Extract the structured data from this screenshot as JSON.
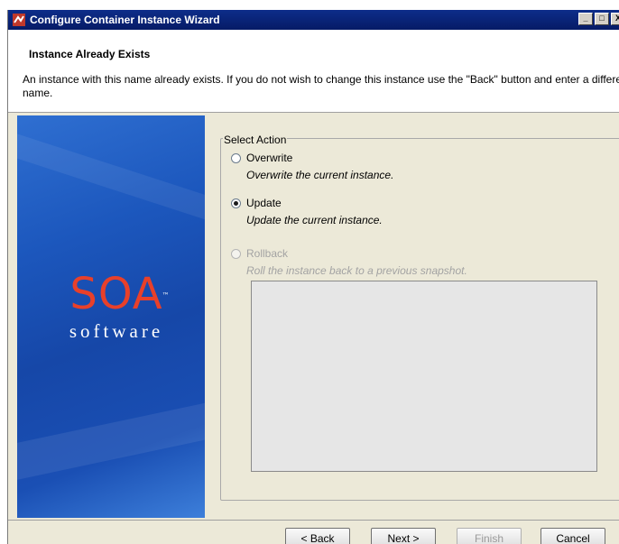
{
  "window": {
    "title": "Configure Container Instance Wizard",
    "controls": [
      "_",
      "□",
      "X"
    ]
  },
  "header": {
    "title": "Instance Already Exists",
    "description": "An instance with this name already exists.  If you do not wish to change this instance use the \"Back\" button and enter a different name."
  },
  "banner": {
    "logo_mark": "SOA",
    "logo_tm": "™",
    "logo_word": "software"
  },
  "select_action": {
    "legend": "Select Action",
    "options": [
      {
        "label": "Overwrite",
        "description": "Overwrite the current instance.",
        "selected": false,
        "enabled": true
      },
      {
        "label": "Update",
        "description": "Update the current instance.",
        "selected": true,
        "enabled": true
      },
      {
        "label": "Rollback",
        "description": "Roll the instance back to a previous snapshot.",
        "selected": false,
        "enabled": false
      }
    ]
  },
  "buttons": {
    "back": "< Back",
    "next": "Next >",
    "finish": "Finish",
    "cancel": "Cancel"
  },
  "colors": {
    "title_bar": "#0a2478",
    "banner_blue": "#1c57bd",
    "logo_red": "#e8402a"
  }
}
